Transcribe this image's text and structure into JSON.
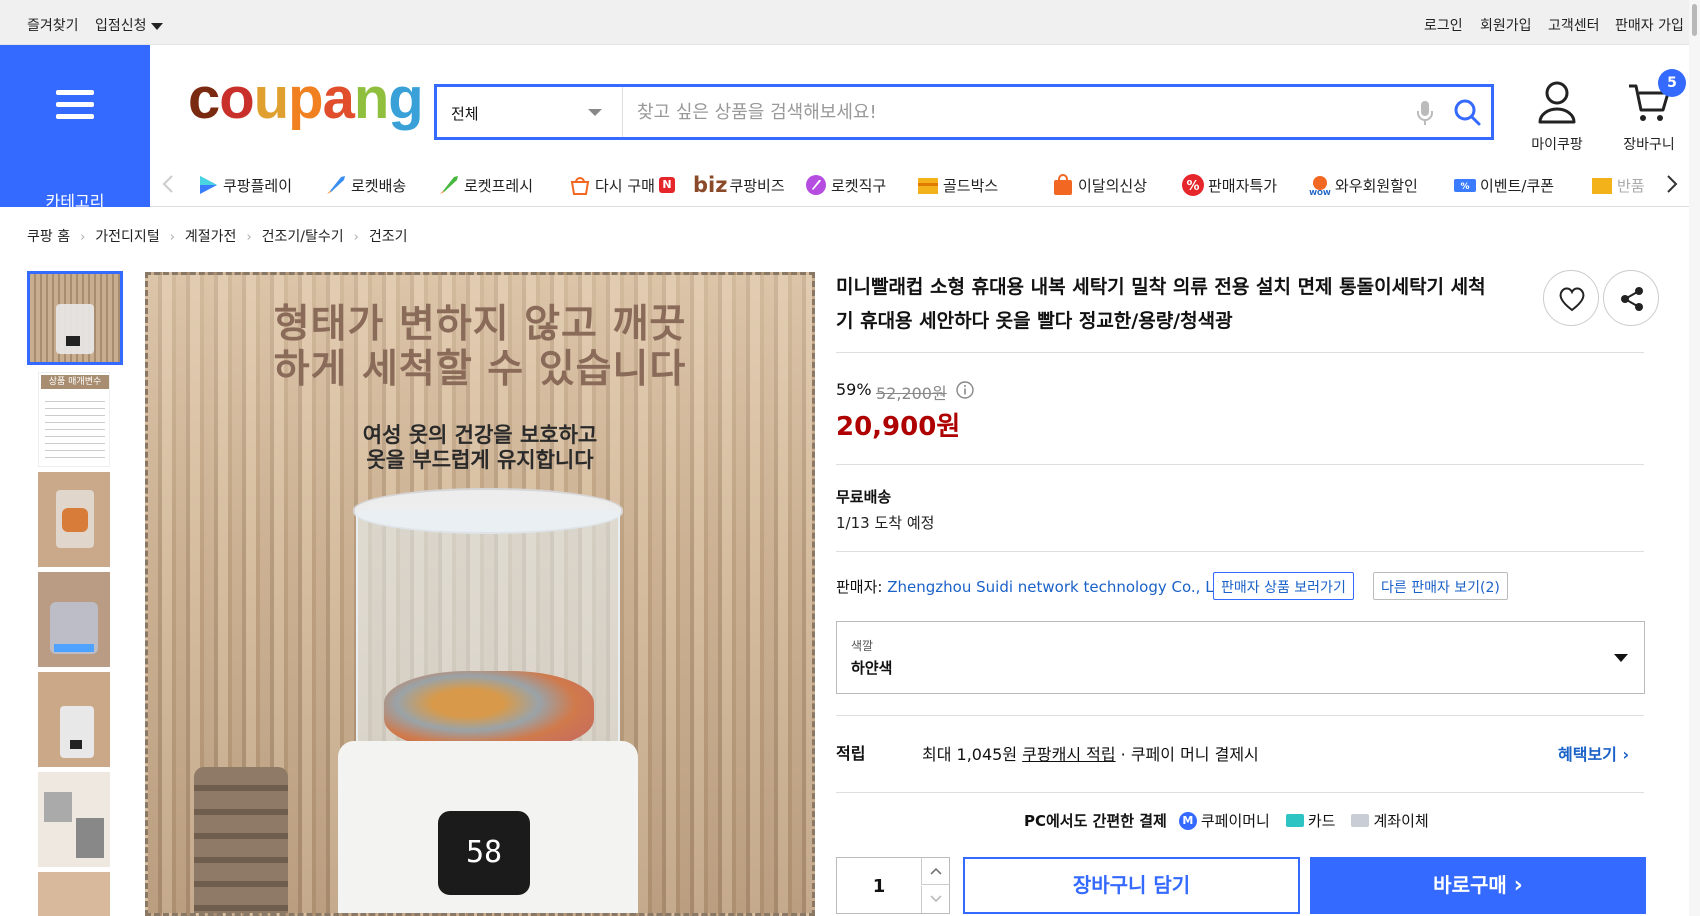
{
  "topbar": {
    "favorites": "즐겨찾기",
    "vendor_apply": "입점신청",
    "login": "로그인",
    "signup": "회원가입",
    "customer_center": "고객센터",
    "seller_join": "판매자 가입"
  },
  "category_button": {
    "label": "카테고리"
  },
  "logo": {
    "letters": [
      "c",
      "o",
      "u",
      "p",
      "a",
      "n",
      "g"
    ]
  },
  "search": {
    "category_selected": "전체",
    "placeholder": "찾고 싶은 상품을 검색해보세요!"
  },
  "header_icons": {
    "my_coupang": "마이쿠팡",
    "cart": "장바구니",
    "cart_count": "5"
  },
  "service_nav": [
    {
      "label": "쿠팡플레이",
      "icon": "play-icon"
    },
    {
      "label": "로켓배송",
      "icon": "rocket-icon"
    },
    {
      "label": "로켓프레시",
      "icon": "rocket-fresh-icon"
    },
    {
      "label": "다시 구매",
      "icon": "rebuy-icon"
    },
    {
      "label": "쿠팡비즈",
      "icon": "biz-icon",
      "prefix": "biz"
    },
    {
      "label": "로켓직구",
      "icon": "rocket-global-icon"
    },
    {
      "label": "골드박스",
      "icon": "goldbox-icon"
    },
    {
      "label": "이달의신상",
      "icon": "new-bag-icon"
    },
    {
      "label": "판매자특가",
      "icon": "percent-icon"
    },
    {
      "label": "와우회원할인",
      "icon": "wow-icon"
    },
    {
      "label": "이벤트/쿠폰",
      "icon": "coupon-icon"
    },
    {
      "label": "반품",
      "icon": "return-icon"
    }
  ],
  "breadcrumb": [
    "쿠팡 홈",
    "가전디지털",
    "계절가전",
    "건조기/탈수기",
    "건조기"
  ],
  "main_image": {
    "headline": "형태가 변하지 않고 깨끗\n하게 세척할 수 있습니다",
    "subline": "여성 옷의 건강을 보호하고\n옷을 부드럽게 유지합니다",
    "display": "58",
    "thumb2_caption": "상품 매개변수"
  },
  "product": {
    "title": "미니빨래컵 소형 휴대용 내복 세탁기 밀착 의류 전용 설치 면제 통돌이세탁기 세척기 휴대용 세안하다 옷을 빨다 정교한/용량/청색광",
    "discount": "59%",
    "original_price": "52,200원",
    "price": "20,900원",
    "shipping_title": "무료배송",
    "arrival": "1/13 도착 예정",
    "seller_label": "판매자:",
    "seller_name": "Zhengzhou Suidi network technology Co., Ltd.",
    "seller_products_button": "판매자 상품 보러가기",
    "other_sellers_button": "다른 판매자 보기(2)",
    "option_label": "색깔",
    "option_value": "하얀색",
    "reward_label": "적립",
    "reward_amount": "최대 1,045원",
    "reward_link": "쿠팡캐시 적립",
    "reward_suffix": "· 쿠페이 머니 결제시",
    "benefit_link": "혜택보기",
    "pay_title": "PC에서도 간편한 결제",
    "pay_methods": [
      "쿠페이머니",
      "카드",
      "계좌이체"
    ],
    "quantity": "1",
    "add_to_cart": "장바구니 담기",
    "buy_now": "바로구매"
  },
  "colors": {
    "accent": "#346aff",
    "price": "#ae0000",
    "link": "#1b62c8"
  }
}
